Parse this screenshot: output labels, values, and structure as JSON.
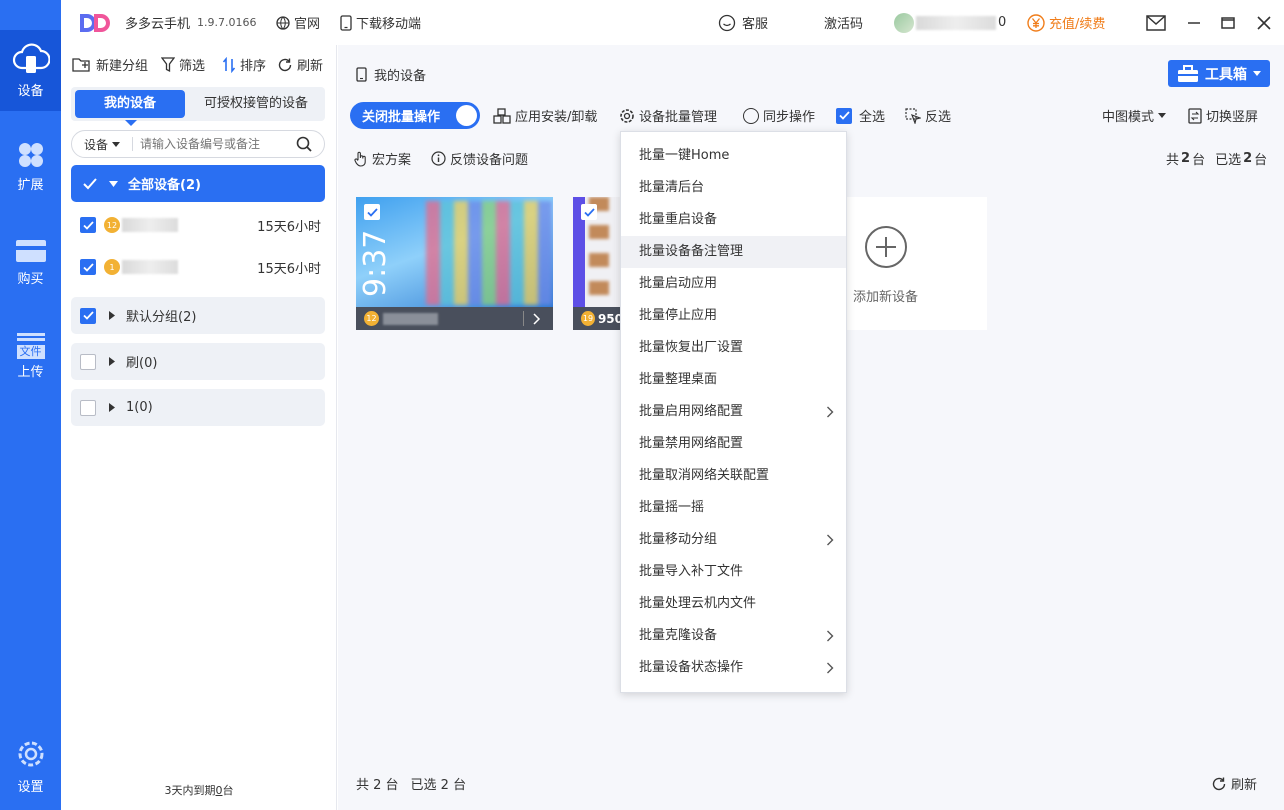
{
  "app": {
    "name": "多多云手机",
    "version": "1.9.7.0166",
    "official_site": "官网",
    "download_mobile": "下载移动端",
    "customer_service": "客服",
    "activation_code": "激活码",
    "account_suffix": "0",
    "recharge": "充值/续费"
  },
  "rail": {
    "devices": "设备",
    "extend": "扩展",
    "buy": "购买",
    "file_badge": "文件",
    "upload": "上传",
    "settings": "设置"
  },
  "sidebar": {
    "new_group": "新建分组",
    "filter": "筛选",
    "sort": "排序",
    "refresh": "刷新",
    "tab_my_devices": "我的设备",
    "tab_authorized": "可授权接管的设备",
    "search_scope": "设备",
    "search_placeholder": "请输入设备编号或备注",
    "all_devices": "全部设备(2)",
    "devices": [
      {
        "level": "12",
        "remaining": "15天6小时"
      },
      {
        "level": "1",
        "remaining": "15天6小时"
      }
    ],
    "groups": [
      "默认分组(2)",
      "刷(0)",
      "1(0)"
    ],
    "expiry_prefix": "3天内到期",
    "expiry_count": "0",
    "expiry_suffix": "台"
  },
  "main": {
    "breadcrumb": "我的设备",
    "toolbox": "工具箱",
    "batch_toggle": "关闭批量操作",
    "app_install": "应用安装/卸载",
    "device_batch_manage": "设备批量管理",
    "sync_ops": "同步操作",
    "select_all": "全选",
    "invert": "反选",
    "view_mode": "中图模式",
    "switch_orientation": "切换竖屏",
    "macro": "宏方案",
    "feedback": "反馈设备问题",
    "total_label": "共",
    "total_count": "2",
    "unit": "台",
    "selected_label": "已选",
    "selected_count": "2",
    "card1_time": "9:37",
    "card1_level": "12",
    "card2_level": "19",
    "card2_text": "950",
    "add_device": "添加新设备",
    "footer_total": "共 2 台",
    "footer_selected": "已选 2 台",
    "footer_refresh": "刷新"
  },
  "dropdown": [
    {
      "label": "批量一键Home",
      "arrow": false
    },
    {
      "label": "批量清后台",
      "arrow": false
    },
    {
      "label": "批量重启设备",
      "arrow": false
    },
    {
      "label": "批量设备备注管理",
      "arrow": false
    },
    {
      "label": "批量启动应用",
      "arrow": false
    },
    {
      "label": "批量停止应用",
      "arrow": false
    },
    {
      "label": "批量恢复出厂设置",
      "arrow": false
    },
    {
      "label": "批量整理桌面",
      "arrow": false
    },
    {
      "label": "批量启用网络配置",
      "arrow": true
    },
    {
      "label": "批量禁用网络配置",
      "arrow": false
    },
    {
      "label": "批量取消网络关联配置",
      "arrow": false
    },
    {
      "label": "批量摇一摇",
      "arrow": false
    },
    {
      "label": "批量移动分组",
      "arrow": true
    },
    {
      "label": "批量导入补丁文件",
      "arrow": false
    },
    {
      "label": "批量处理云机内文件",
      "arrow": false
    },
    {
      "label": "批量克隆设备",
      "arrow": true
    },
    {
      "label": "批量设备状态操作",
      "arrow": true
    }
  ],
  "colors": {
    "primary": "#2a6ff2",
    "rail_active": "#1756d9",
    "recharge": "#f07d1a",
    "level_badge": "#f2b134"
  }
}
